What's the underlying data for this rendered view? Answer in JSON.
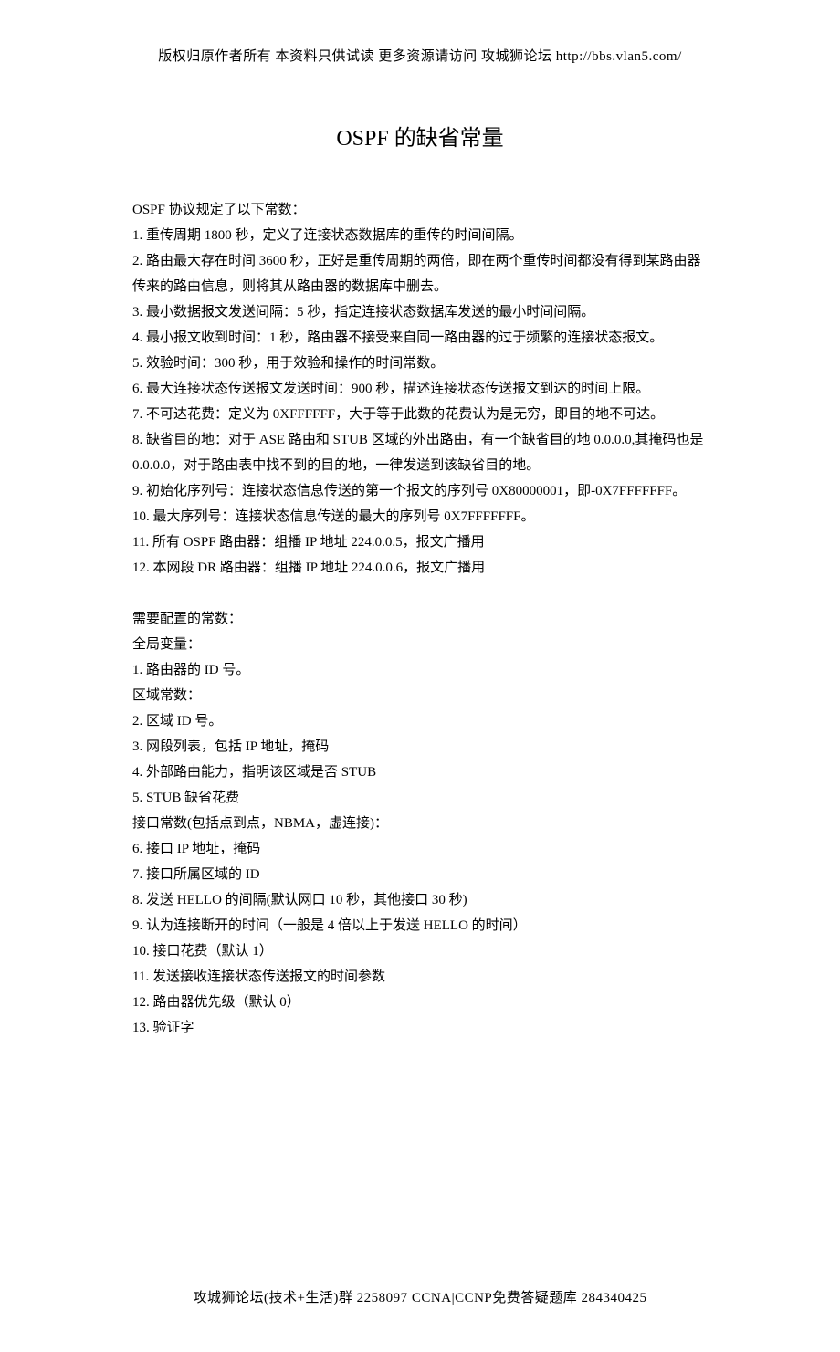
{
  "header": "版权归原作者所有 本资料只供试读 更多资源请访问 攻城狮论坛 http://bbs.vlan5.com/",
  "title": "OSPF 的缺省常量",
  "intro1": "OSPF 协议规定了以下常数：",
  "items1": [
    "1.   重传周期 1800 秒，定义了连接状态数据库的重传的时间间隔。",
    "2.   路由最大存在时间 3600 秒，正好是重传周期的两倍，即在两个重传时间都没有得到某路由器传来的路由信息，则将其从路由器的数据库中删去。",
    "3.   最小数据报文发送间隔：5 秒，指定连接状态数据库发送的最小时间间隔。",
    "4.   最小报文收到时间：1 秒，路由器不接受来自同一路由器的过于频繁的连接状态报文。",
    "5.   效验时间：300 秒，用于效验和操作的时间常数。",
    "6.   最大连接状态传送报文发送时间：900 秒，描述连接状态传送报文到达的时间上限。",
    "7.   不可达花费：定义为 0XFFFFFF，大于等于此数的花费认为是无穷，即目的地不可达。",
    "8.   缺省目的地：对于 ASE 路由和 STUB 区域的外出路由，有一个缺省目的地 0.0.0.0,其掩码也是 0.0.0.0，对于路由表中找不到的目的地，一律发送到该缺省目的地。",
    "9.  初始化序列号：连接状态信息传送的第一个报文的序列号 0X80000001，即-0X7FFFFFFF。",
    "10.   最大序列号：连接状态信息传送的最大的序列号 0X7FFFFFFF。",
    "11.   所有 OSPF 路由器：组播 IP 地址 224.0.0.5，报文广播用",
    "12.   本网段 DR 路由器：组播 IP 地址 224.0.0.6，报文广播用"
  ],
  "sub1": "需要配置的常数：",
  "sub2": "全局变量：",
  "items2": [
    "1.   路由器的 ID 号。"
  ],
  "sub3": "区域常数：",
  "items3": [
    "2.   区域 ID 号。",
    "3.   网段列表，包括 IP 地址，掩码",
    "4.   外部路由能力，指明该区域是否 STUB",
    "5.   STUB 缺省花费"
  ],
  "sub4": "接口常数(包括点到点，NBMA，虚连接)：",
  "items4": [
    "6.   接口 IP 地址，掩码",
    "7.   接口所属区域的 ID",
    "8.   发送 HELLO 的间隔(默认网口 10 秒，其他接口 30 秒)",
    "9.   认为连接断开的时间（一般是 4 倍以上于发送 HELLO 的时间）",
    "10.   接口花费（默认 1）",
    "11.   发送接收连接状态传送报文的时间参数",
    "12.   路由器优先级（默认 0）",
    "13.   验证字"
  ],
  "footer": "攻城狮论坛(技术+生活)群 2258097 CCNA|CCNP免费答疑题库 284340425"
}
